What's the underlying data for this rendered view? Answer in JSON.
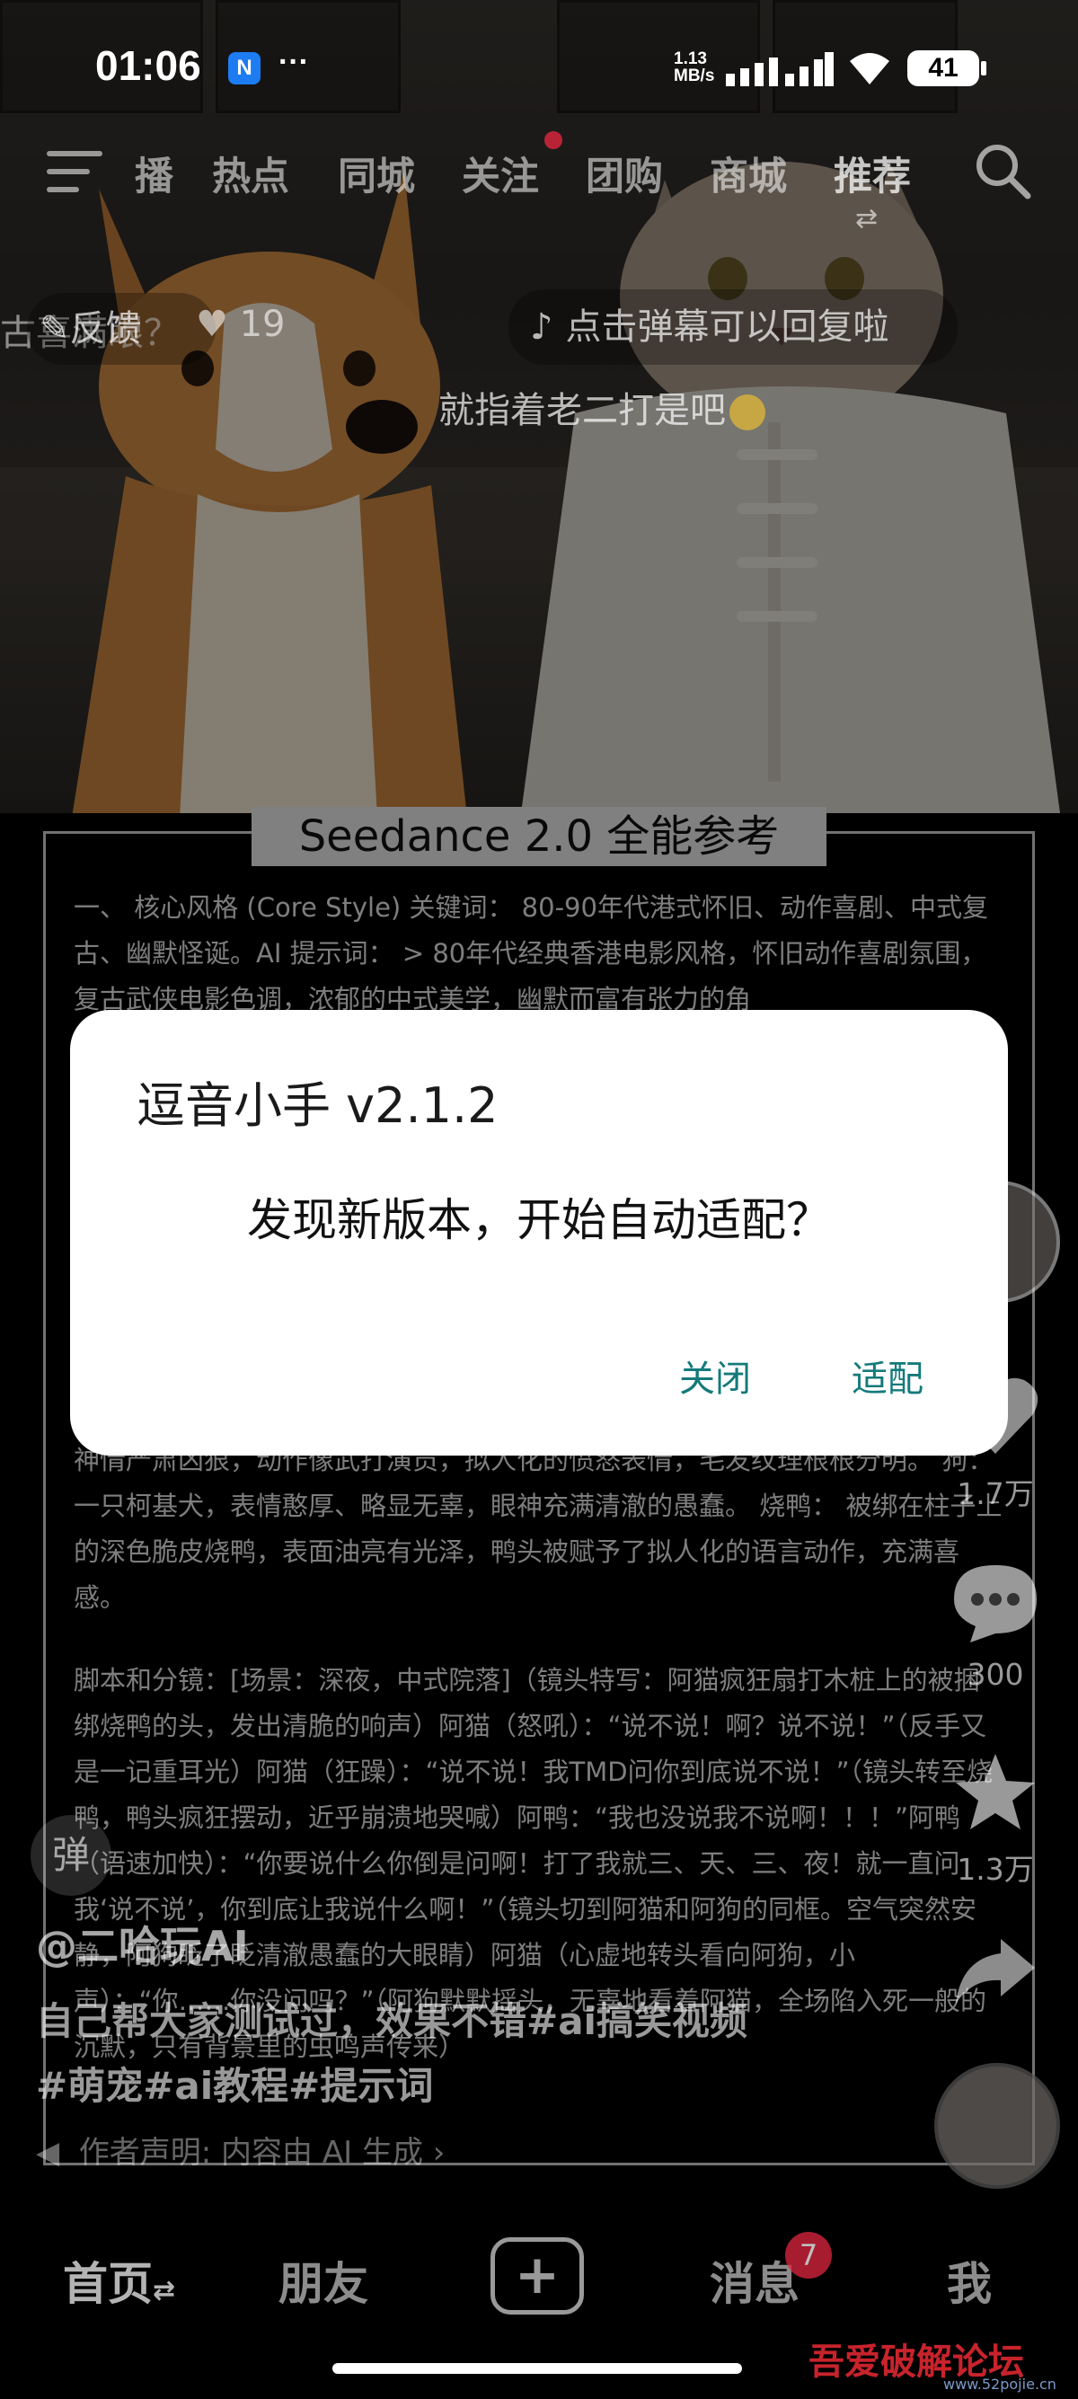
{
  "status_bar": {
    "time": "01:06",
    "notif_badge": "N",
    "more": "···",
    "net_speed_value": "1.13",
    "net_speed_unit": "MB/s",
    "battery": "41"
  },
  "top_nav": {
    "tabs": [
      "播",
      "热点",
      "同城",
      "关注",
      "团购",
      "商城",
      "推荐"
    ],
    "active_tab": "推荐"
  },
  "danmu": {
    "left_fragment": "古喜满眼？",
    "feedback": "反馈",
    "like_count": "19",
    "hint": "点击弹幕可以回复啦",
    "comment": "就指着老二打是吧"
  },
  "article": {
    "title": "Seedance 2.0 全能参考",
    "para1": "一、 核心风格 (Core Style) 关键词： 80-90年代港式怀旧、动作喜剧、中式复古、幽默怪诞。AI 提示词： > 80年代经典香港电影风格，怀旧动作喜剧氛围，复古武侠电影色调，浓郁的中式美学，幽默而富有张力的角",
    "para2": "神情严肃凶狠，动作像武打演员，拟人化的愤怒表情，毛发纹理根根分明。 狗： 一只柯基犬，表情憨厚、略显无辜，眼神充满清澈的愚蠢。 烧鸭： 被绑在柱子上的深色脆皮烧鸭，表面油亮有光泽，鸭头被赋予了拟人化的语言动作，充满喜感。",
    "para3": "脚本和分镜：[场景：深夜，中式院落]（镜头特写：阿猫疯狂扇打木桩上的被捆绑烧鸭的头，发出清脆的响声）阿猫（怒吼）：“说不说！啊？说不说！”（反手又是一记重耳光）阿猫（狂躁）：“说不说！我TMD问你到底说不说！”（镜头转至烧鸭，鸭头疯狂摆动，近乎崩溃地哭喊）阿鸭：“我也没说我不说啊！！！”阿鸭（语速加快）：“你要说什么你倒是问啊！打了我就三、天、三、夜！就一直问我‘说不说’，你到底让我说什么啊！”（镜头切到阿猫和阿狗的同框。空气突然安静，阿狗眨了眨清澈愚蠢的大眼睛）阿猫（心虚地转头看向阿狗，小声）：“你……你没问吗？”（阿狗默默摇头，无辜地看着阿猫，全场陷入死一般的沉默，只有背景里的虫鸣声传来）"
  },
  "right_rail": {
    "like_count": "1.7万",
    "comment_count": "300",
    "favorite_count": "1.3万"
  },
  "overlay": {
    "danmu_button": "弹",
    "author": "@二哈玩AI",
    "caption": "自己帮大家测试过，效果不错#ai搞笑视频",
    "tags": "#萌宠#ai教程#提示词",
    "disclaimer": "作者声明: 内容由 AI 生成"
  },
  "dialog": {
    "title": "逗音小手 v2.1.2",
    "message": "发现新版本，开始自动适配？",
    "close_label": "关闭",
    "confirm_label": "适配"
  },
  "bottom_nav": {
    "home": "首页",
    "friends": "朋友",
    "messages": "消息",
    "messages_badge": "7",
    "me": "我"
  },
  "watermark": {
    "text": "吾爱破解论坛",
    "url": "www.52pojie.cn"
  },
  "colors": {
    "dialog_button": "#147a7a",
    "badge_red": "#e0263f"
  }
}
